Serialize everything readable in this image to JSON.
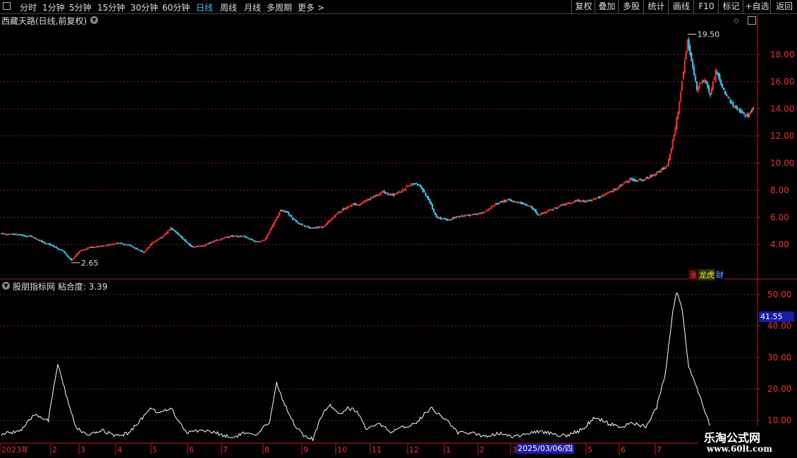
{
  "toolbar": {
    "periods": [
      "分时",
      "1分钟",
      "5分钟",
      "15分钟",
      "30分钟",
      "60分钟",
      "日线",
      "周线",
      "月线",
      "多周期",
      "更多 >"
    ],
    "active_period": "日线",
    "right_buttons": [
      "复权",
      "叠加",
      "多股",
      "统计",
      "画线",
      "F10",
      "标记",
      "+自选",
      "返回"
    ]
  },
  "main_chart": {
    "title": "西藏天路(日线,前复权)",
    "high_label": "19.50",
    "low_label": "2.65",
    "badges": [
      "涨",
      "龙虎",
      "财"
    ]
  },
  "indicator": {
    "title": "股朋指标网",
    "value_label": "粘合度: 3.39",
    "current_value": "41.55"
  },
  "date_badge": "2025/03/06/四",
  "watermark": {
    "line1": "乐淘公式网",
    "line2": "www.60lt.com"
  },
  "colors": {
    "up": "#ff3333",
    "down": "#39c5e8",
    "grid": "#8a1a1a",
    "axis": "#b22",
    "line": "#ffffff",
    "flat": "#ffffff"
  },
  "chart_data": [
    {
      "type": "candlestick",
      "title": "西藏天路(日线,前复权)",
      "y_ticks": [
        "18.00",
        "16.00",
        "14.00",
        "12.00",
        "10.00",
        "8.00",
        "6.00",
        "4.00"
      ],
      "ylim": [
        1.5,
        20.2
      ],
      "annotations": [
        {
          "label": "19.50",
          "type": "high"
        },
        {
          "label": "2.65",
          "type": "low"
        }
      ],
      "close_trend": [
        [
          0,
          4.8
        ],
        [
          12,
          4.7
        ],
        [
          22,
          4.6
        ],
        [
          30,
          4.2
        ],
        [
          38,
          3.9
        ],
        [
          46,
          3.5
        ],
        [
          52,
          2.8
        ],
        [
          58,
          3.5
        ],
        [
          66,
          3.8
        ],
        [
          76,
          3.9
        ],
        [
          86,
          4.1
        ],
        [
          96,
          3.9
        ],
        [
          106,
          3.4
        ],
        [
          112,
          4.1
        ],
        [
          120,
          4.6
        ],
        [
          126,
          5.2
        ],
        [
          134,
          4.5
        ],
        [
          142,
          3.8
        ],
        [
          150,
          3.9
        ],
        [
          160,
          4.3
        ],
        [
          170,
          4.6
        ],
        [
          180,
          4.6
        ],
        [
          190,
          4.2
        ],
        [
          196,
          4.3
        ],
        [
          202,
          5.4
        ],
        [
          208,
          6.5
        ],
        [
          212,
          6.4
        ],
        [
          220,
          5.6
        ],
        [
          230,
          5.2
        ],
        [
          240,
          5.3
        ],
        [
          250,
          6.3
        ],
        [
          260,
          6.9
        ],
        [
          268,
          7.0
        ],
        [
          276,
          7.5
        ],
        [
          284,
          7.9
        ],
        [
          292,
          7.6
        ],
        [
          300,
          8.1
        ],
        [
          306,
          8.5
        ],
        [
          312,
          8.3
        ],
        [
          318,
          7.3
        ],
        [
          324,
          6.0
        ],
        [
          332,
          5.8
        ],
        [
          342,
          6.1
        ],
        [
          352,
          6.2
        ],
        [
          360,
          6.4
        ],
        [
          368,
          7.0
        ],
        [
          378,
          7.3
        ],
        [
          386,
          7.1
        ],
        [
          394,
          6.8
        ],
        [
          400,
          6.2
        ],
        [
          408,
          6.5
        ],
        [
          418,
          6.9
        ],
        [
          428,
          7.2
        ],
        [
          438,
          7.2
        ],
        [
          448,
          7.6
        ],
        [
          456,
          8.0
        ],
        [
          462,
          8.4
        ],
        [
          468,
          8.8
        ],
        [
          474,
          8.7
        ],
        [
          482,
          8.9
        ],
        [
          490,
          9.4
        ],
        [
          496,
          9.8
        ],
        [
          500,
          11.6
        ],
        [
          504,
          13.8
        ],
        [
          508,
          16.8
        ],
        [
          511,
          19.0
        ],
        [
          514,
          17.6
        ],
        [
          518,
          15.5
        ],
        [
          524,
          16.2
        ],
        [
          528,
          15.0
        ],
        [
          532,
          16.8
        ],
        [
          538,
          15.3
        ],
        [
          544,
          14.4
        ],
        [
          550,
          13.8
        ],
        [
          556,
          13.4
        ],
        [
          560,
          14.0
        ]
      ]
    },
    {
      "type": "line",
      "title": "粘合度",
      "y_ticks": [
        "50.00",
        "40.00",
        "30.00",
        "20.00",
        "10.00"
      ],
      "ylim": [
        3,
        54
      ],
      "series": [
        {
          "name": "粘合度",
          "points": [
            [
              0,
              5.5
            ],
            [
              15,
              7
            ],
            [
              25,
              12
            ],
            [
              35,
              10
            ],
            [
              42,
              28
            ],
            [
              47,
              20
            ],
            [
              55,
              8
            ],
            [
              65,
              5
            ],
            [
              75,
              7
            ],
            [
              85,
              5
            ],
            [
              95,
              6
            ],
            [
              105,
              11
            ],
            [
              112,
              14
            ],
            [
              118,
              12
            ],
            [
              126,
              14
            ],
            [
              132,
              10
            ],
            [
              138,
              6
            ],
            [
              148,
              7
            ],
            [
              160,
              6
            ],
            [
              172,
              4.5
            ],
            [
              180,
              6
            ],
            [
              190,
              5
            ],
            [
              200,
              10
            ],
            [
              205,
              22
            ],
            [
              210,
              16
            ],
            [
              218,
              9
            ],
            [
              225,
              5
            ],
            [
              232,
              4
            ],
            [
              240,
              13
            ],
            [
              245,
              15
            ],
            [
              252,
              12
            ],
            [
              258,
              14
            ],
            [
              265,
              13
            ],
            [
              272,
              7
            ],
            [
              282,
              9
            ],
            [
              290,
              6
            ],
            [
              300,
              8
            ],
            [
              308,
              9
            ],
            [
              315,
              12
            ],
            [
              320,
              14
            ],
            [
              326,
              12
            ],
            [
              332,
              10
            ],
            [
              340,
              6
            ],
            [
              350,
              6
            ],
            [
              360,
              5
            ],
            [
              370,
              6
            ],
            [
              380,
              5
            ],
            [
              390,
              5.5
            ],
            [
              400,
              6.5
            ],
            [
              410,
              6
            ],
            [
              420,
              5
            ],
            [
              432,
              7
            ],
            [
              442,
              11
            ],
            [
              452,
              9
            ],
            [
              462,
              8
            ],
            [
              470,
              9
            ],
            [
              480,
              8
            ],
            [
              488,
              14
            ],
            [
              495,
              26
            ],
            [
              500,
              45
            ],
            [
              503,
              51
            ],
            [
              507,
              45
            ],
            [
              512,
              27
            ],
            [
              518,
              20
            ],
            [
              524,
              13
            ],
            [
              528,
              8
            ],
            [
              532,
              6
            ]
          ]
        }
      ]
    }
  ]
}
